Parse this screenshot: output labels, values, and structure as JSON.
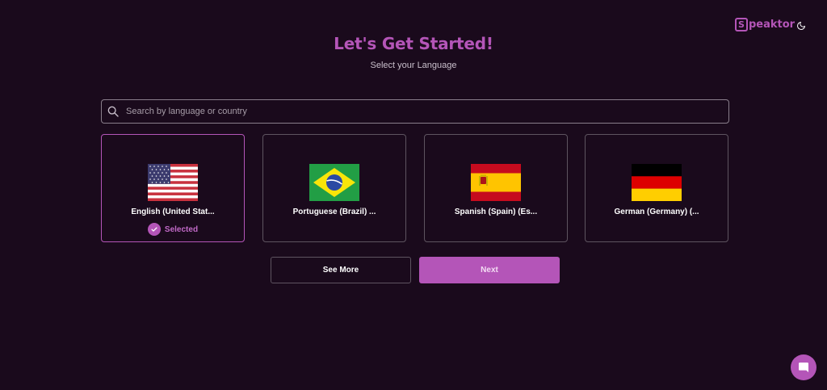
{
  "brand": {
    "logo_letter": "S",
    "name_rest": "peaktor",
    "color": "#b455b8"
  },
  "header": {
    "theme_toggle_icon": "moon-icon"
  },
  "main": {
    "title": "Let's Get Started!",
    "subtitle": "Select your Language"
  },
  "search": {
    "placeholder": "Search by language or country",
    "value": "",
    "icon": "search-icon"
  },
  "languages": [
    {
      "label": "English (United Stat...",
      "flag": "us-flag-icon",
      "selected": true,
      "selected_label": "Selected"
    },
    {
      "label": "Portuguese (Brazil) ...",
      "flag": "brazil-flag-icon",
      "selected": false
    },
    {
      "label": "Spanish (Spain) (Es...",
      "flag": "spain-flag-icon",
      "selected": false
    },
    {
      "label": "German (Germany) (...",
      "flag": "germany-flag-icon",
      "selected": false
    }
  ],
  "actions": {
    "see_more": "See More",
    "next": "Next"
  },
  "chat": {
    "icon": "chat-icon"
  },
  "colors": {
    "background": "#1a0a1c",
    "accent": "#b455b8",
    "border": "#5e5460"
  }
}
